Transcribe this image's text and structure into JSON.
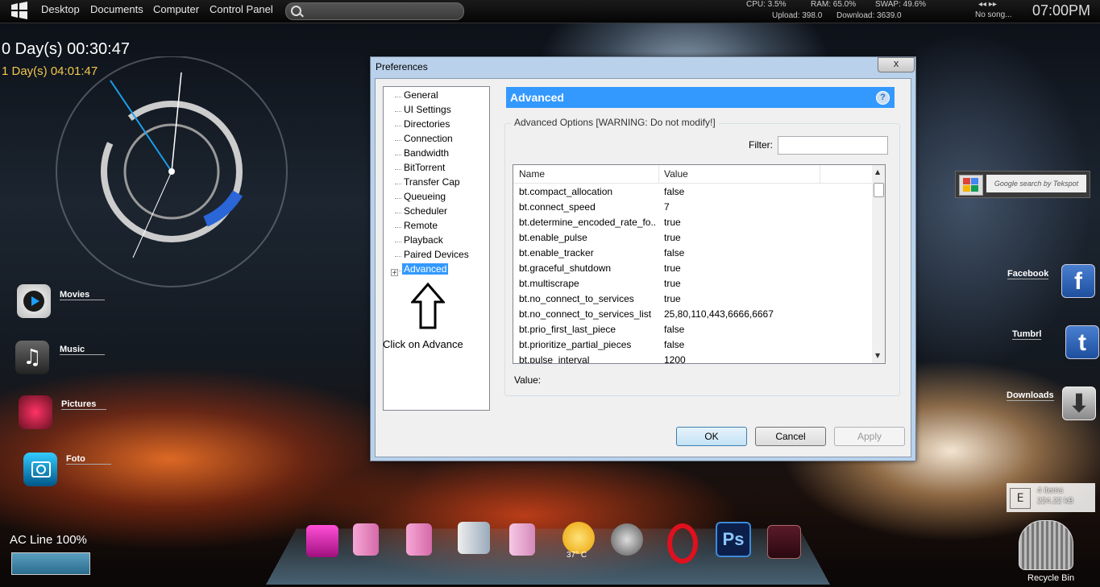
{
  "taskbar": {
    "links": [
      "Desktop",
      "Documents",
      "Computer",
      "Control Panel"
    ],
    "cpu": "CPU: 3.5%",
    "ram": "RAM: 65.0%",
    "swap": "SWAP: 49.6%",
    "upload": "Upload: 398.0",
    "download": "Download: 3639.0",
    "song": "No song...",
    "clock": "07:00PM"
  },
  "widgets": {
    "uptime": "0 Day(s) 00:30:47",
    "uptime2": "1 Day(s) 04:01:47",
    "ac_line": "AC Line 100%",
    "ac_level": 1.0,
    "launcher": [
      "Movies",
      "Music",
      "Pictures",
      "Foto"
    ],
    "google_search": "Google search by Tekspot",
    "social": [
      "Facebook",
      "Tumbrl",
      "Downloads"
    ],
    "recycle_items": "4 items",
    "recycle_size": "224.22 kB",
    "recycle_drive": "E",
    "recycle_label": "Recycle Bin",
    "weather": "37° C"
  },
  "dialog": {
    "title": "Preferences",
    "close": "x",
    "tree": [
      "General",
      "UI Settings",
      "Directories",
      "Connection",
      "Bandwidth",
      "BitTorrent",
      "Transfer Cap",
      "Queueing",
      "Scheduler",
      "Remote",
      "Playback",
      "Paired Devices",
      "Advanced"
    ],
    "annotation": "Click on Advance",
    "header": "Advanced",
    "help": "?",
    "group_label": "Advanced Options [WARNING: Do not modify!]",
    "filter_label": "Filter:",
    "filter_value": "",
    "columns": [
      "Name",
      "Value"
    ],
    "rows": [
      {
        "name": "bt.compact_allocation",
        "value": "false"
      },
      {
        "name": "bt.connect_speed",
        "value": "7"
      },
      {
        "name": "bt.determine_encoded_rate_fo...",
        "value": "true"
      },
      {
        "name": "bt.enable_pulse",
        "value": "true"
      },
      {
        "name": "bt.enable_tracker",
        "value": "false"
      },
      {
        "name": "bt.graceful_shutdown",
        "value": "true"
      },
      {
        "name": "bt.multiscrape",
        "value": "true"
      },
      {
        "name": "bt.no_connect_to_services",
        "value": "true"
      },
      {
        "name": "bt.no_connect_to_services_list",
        "value": "25,80,110,443,6666,6667"
      },
      {
        "name": "bt.prio_first_last_piece",
        "value": "false"
      },
      {
        "name": "bt.prioritize_partial_pieces",
        "value": "false"
      },
      {
        "name": "bt.pulse_interval",
        "value": "1200"
      }
    ],
    "value_label": "Value:",
    "ok": "OK",
    "cancel": "Cancel",
    "apply": "Apply"
  },
  "colors": {
    "accent": "#3399ff",
    "uptime2": "#f2c84b"
  }
}
